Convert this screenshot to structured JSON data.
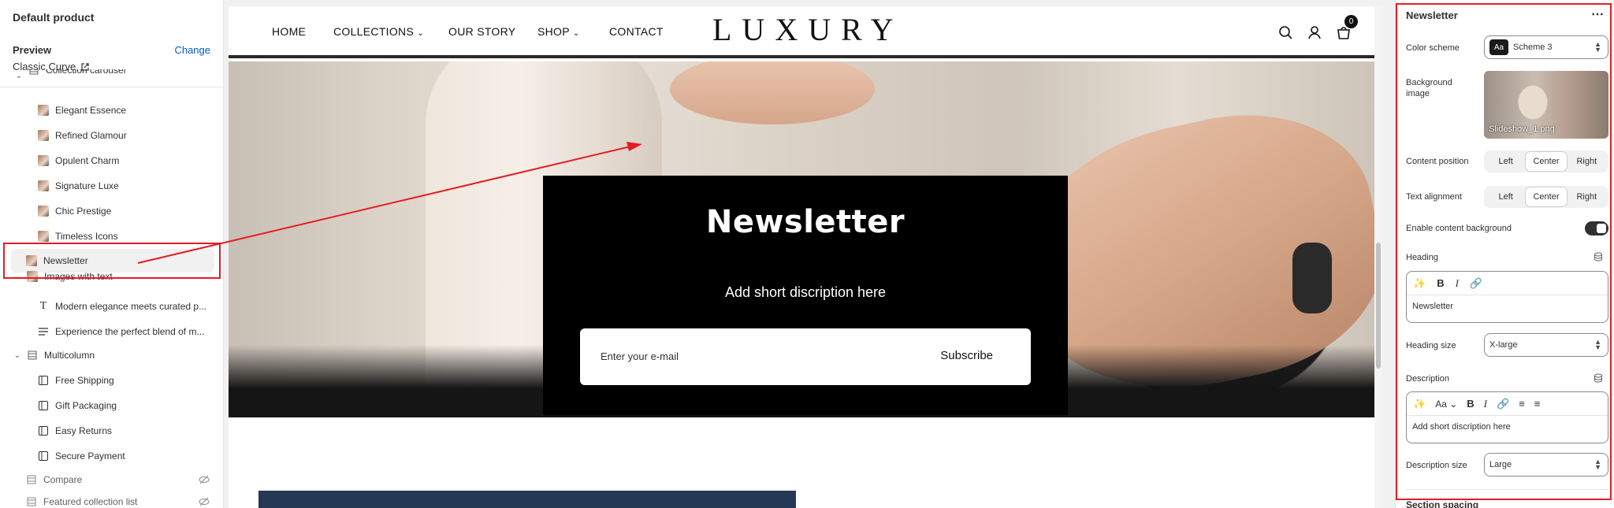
{
  "sidebar": {
    "title": "Default product",
    "preview_label": "Preview",
    "change_label": "Change",
    "theme_name": "Classic Curve",
    "items": [
      {
        "label": "Collection carousel",
        "type": "section"
      },
      {
        "label": "Elegant Essence",
        "type": "block"
      },
      {
        "label": "Refined Glamour",
        "type": "block"
      },
      {
        "label": "Opulent Charm",
        "type": "block"
      },
      {
        "label": "Signature Luxe",
        "type": "block"
      },
      {
        "label": "Chic Prestige",
        "type": "block"
      },
      {
        "label": "Timeless Icons",
        "type": "block"
      },
      {
        "label": "Newsletter",
        "type": "section",
        "selected": true
      },
      {
        "label": "Images with text",
        "type": "section"
      },
      {
        "label": "Modern elegance meets curated p...",
        "type": "text-block"
      },
      {
        "label": "Experience the perfect blend of m...",
        "type": "text-block"
      },
      {
        "label": "Multicolumn",
        "type": "section"
      },
      {
        "label": "Free Shipping",
        "type": "column"
      },
      {
        "label": "Gift Packaging",
        "type": "column"
      },
      {
        "label": "Easy Returns",
        "type": "column"
      },
      {
        "label": "Secure Payment",
        "type": "column"
      },
      {
        "label": "Compare",
        "type": "hidden-section"
      },
      {
        "label": "Featured collection list",
        "type": "hidden-section"
      }
    ]
  },
  "store": {
    "nav": [
      "HOME",
      "COLLECTIONS",
      "OUR STORY",
      "SHOP",
      "CONTACT"
    ],
    "logo": "LUXURY",
    "cart_count": "0",
    "newsletter": {
      "heading": "Newsletter",
      "description": "Add short discription here",
      "input_placeholder": "Enter your e-mail",
      "button": "Subscribe"
    }
  },
  "panel": {
    "title": "Newsletter",
    "more": "⋯",
    "color_scheme_label": "Color scheme",
    "color_scheme_value": "Scheme 3",
    "color_scheme_swatch": "Aa",
    "bg_image_label": "Background image",
    "bg_image_file": "Slideshow_1.png",
    "content_position_label": "Content position",
    "text_alignment_label": "Text alignment",
    "position_options": [
      "Left",
      "Center",
      "Right"
    ],
    "selected_position": "Center",
    "selected_alignment": "Center",
    "enable_bg_label": "Enable content background",
    "enable_bg_value": true,
    "heading_label": "Heading",
    "heading_value": "Newsletter",
    "heading_size_label": "Heading size",
    "heading_size_value": "X-large",
    "description_label": "Description",
    "description_value": "Add short discription here",
    "description_size_label": "Description size",
    "description_size_value": "Large",
    "next_section": "Section spacing"
  },
  "colors": {
    "accent_link": "#005bd3",
    "annotation_red": "#e51c23",
    "newsletter_bg": "#000000"
  }
}
